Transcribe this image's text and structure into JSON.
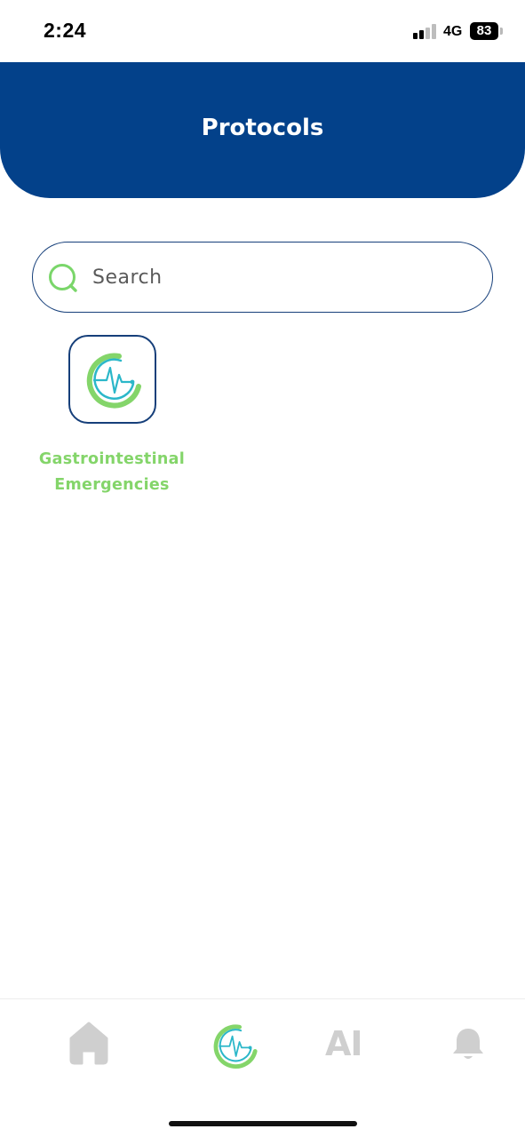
{
  "status_bar": {
    "time": "2:24",
    "network": "4G",
    "battery": "83"
  },
  "header": {
    "title": "Protocols"
  },
  "search": {
    "placeholder": "Search",
    "value": "",
    "icon": "search-icon"
  },
  "protocols": [
    {
      "label": "Gastrointestinal Emergencies",
      "icon": "heartbeat-logo-icon"
    }
  ],
  "bottom_nav": {
    "items": [
      {
        "name": "home",
        "icon": "home-icon",
        "active": false
      },
      {
        "name": "protocols",
        "icon": "heartbeat-logo-icon",
        "active": true
      },
      {
        "name": "ai",
        "label": "AI",
        "active": false
      },
      {
        "name": "notifications",
        "icon": "bell-icon",
        "active": false
      }
    ]
  },
  "colors": {
    "brand_blue": "#03418a",
    "accent_green": "#84d56a",
    "accent_teal": "#2bb7c9",
    "inactive_gray": "#cfcfcf"
  }
}
